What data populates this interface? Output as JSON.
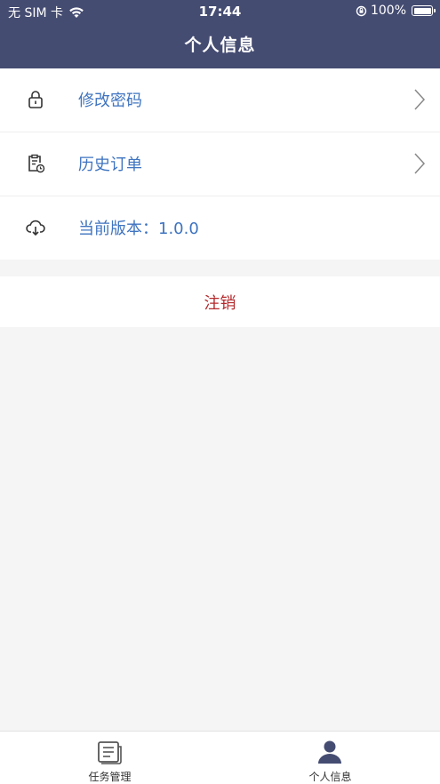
{
  "status_bar": {
    "carrier": "无 SIM 卡",
    "time": "17:44",
    "battery": "100%"
  },
  "header": {
    "title": "个人信息"
  },
  "menu": [
    {
      "label": "修改密码",
      "icon": "lock-icon"
    },
    {
      "label": "历史订单",
      "icon": "order-history-icon"
    },
    {
      "label": "当前版本：1.0.0",
      "icon": "cloud-download-icon"
    }
  ],
  "logout": {
    "label": "注销"
  },
  "tabbar": {
    "tabs": [
      {
        "label": "任务管理",
        "icon": "task-list-icon"
      },
      {
        "label": "个人信息",
        "icon": "person-icon"
      }
    ]
  },
  "colors": {
    "header_bg": "#454c72",
    "label_blue": "#3f74c0",
    "logout_red": "#b4292c",
    "active_tab": "#454c72"
  }
}
